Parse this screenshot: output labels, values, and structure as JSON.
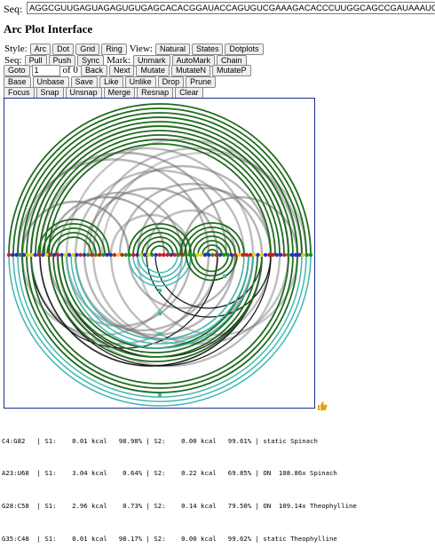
{
  "sequence": {
    "label": "Seq:",
    "value": "AGGCGUUGAGUAGAGUGUGAGCACACGGAUACCAGUGUCGAAAGACACCCUUGGCAGCCGAUAAAUGUGAAGGACGGGUCC"
  },
  "title": "Arc Plot Interface",
  "toolbar1": {
    "style_label": "Style:",
    "style_buttons": [
      "Arc",
      "Dot",
      "Grid",
      "Ring"
    ],
    "view_label": "View:",
    "view_buttons": [
      "Natural",
      "States",
      "Dotplots"
    ]
  },
  "toolbar2": {
    "seq_label": "Seq:",
    "seq_buttons": [
      "Pull",
      "Push",
      "Sync"
    ],
    "mark_label": "Mark:",
    "mark_buttons": [
      "Unmark",
      "AutoMark",
      "Chain"
    ]
  },
  "toolbar3": {
    "goto_label": "Goto",
    "goto_value": "1",
    "of_label": "of 0",
    "buttons": [
      "Back",
      "Next",
      "Mutate",
      "MutateN",
      "MutateP"
    ]
  },
  "toolbar4": {
    "buttons": [
      "Base",
      "Unbase",
      "Save",
      "Like",
      "Unlike",
      "Drop",
      "Prune"
    ]
  },
  "toolbar5": {
    "buttons": [
      "Focus",
      "Snap",
      "Unsnap",
      "Merge",
      "Resnap",
      "Clear"
    ]
  },
  "colors": {
    "green_arc": "#1f6b1f",
    "cyan_arc": "#3fb8b0",
    "black_arc": "#111111",
    "gray_arc": "#8a8a8a",
    "canvas_border": "#1a2d8f",
    "nucleotide_red": "#d21b1b",
    "nucleotide_yellow": "#e3d21a",
    "nucleotide_blue": "#2430c8",
    "nucleotide_green": "#1f8f1f",
    "thumb": "#e2a400"
  },
  "results": [
    "C4:G82   | S1:    0.01 kcal   98.98% | S2:    0.00 kcal   99.61% | static Spinach",
    "A23:U68  | S1:    3.04 kcal    0.64% | S2:    0.22 kcal   69.85% | ON  108.86x Spinach",
    "G28:C58  | S1:    2.96 kcal    0.73% | S2:    0.14 kcal   79.50% | ON  109.14x Theophylline",
    "G35:C48  | S1:    0.01 kcal   98.17% | S2:    0.00 kcal   99.62% | static Theophylline"
  ],
  "icons": {
    "like": "thumbs-up-icon"
  }
}
